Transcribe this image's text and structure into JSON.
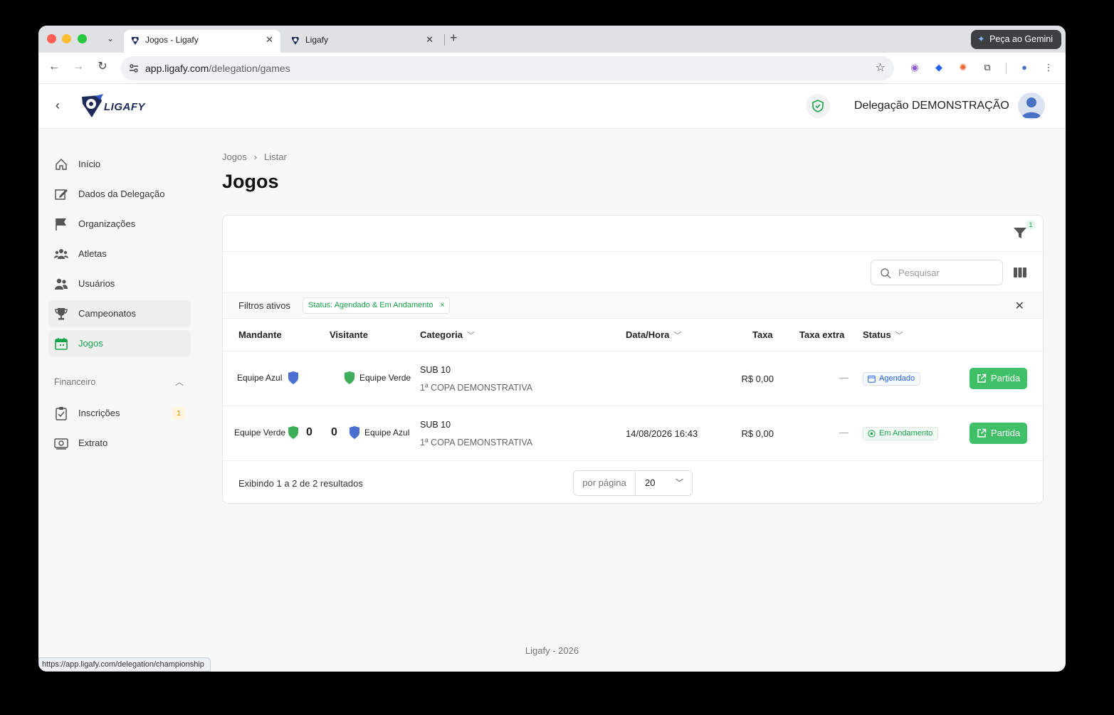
{
  "browser": {
    "tabs": [
      {
        "title": "Jogos - Ligafy",
        "active": true
      },
      {
        "title": "Ligafy",
        "active": false
      }
    ],
    "gemini_label": "Peça ao Gemini",
    "url_host": "app.ligafy.com",
    "url_path": "/delegation/games",
    "status_url": "https://app.ligafy.com/delegation/championship"
  },
  "header": {
    "logo_text": "LIGAFY",
    "delegation_name": "Delegação DEMONSTRAÇÃO"
  },
  "sidebar": {
    "items": [
      {
        "label": "Início",
        "icon": "home-icon"
      },
      {
        "label": "Dados da Delegação",
        "icon": "edit-icon"
      },
      {
        "label": "Organizações",
        "icon": "flag-icon"
      },
      {
        "label": "Atletas",
        "icon": "group-icon"
      },
      {
        "label": "Usuários",
        "icon": "users-icon"
      },
      {
        "label": "Campeonatos",
        "icon": "trophy-icon"
      },
      {
        "label": "Jogos",
        "icon": "calendar-icon"
      }
    ],
    "section_label": "Financeiro",
    "finance_items": [
      {
        "label": "Inscrições",
        "badge": "1",
        "icon": "clipboard-icon"
      },
      {
        "label": "Extrato",
        "icon": "money-icon"
      }
    ]
  },
  "breadcrumb": {
    "parent": "Jogos",
    "current": "Listar"
  },
  "page_title": "Jogos",
  "filter_count": "1",
  "search": {
    "placeholder": "Pesquisar"
  },
  "active_filters": {
    "label": "Filtros ativos",
    "chip": "Status: Agendado & Em Andamento",
    "chip_remove": "×"
  },
  "table": {
    "headers": {
      "mandante": "Mandante",
      "visitante": "Visitante",
      "categoria": "Categoria",
      "datahora": "Data/Hora",
      "taxa": "Taxa",
      "taxa_extra": "Taxa extra",
      "status": "Status"
    },
    "rows": [
      {
        "home": "Equipe Azul",
        "away": "Equipe Verde",
        "home_score": "",
        "away_score": "",
        "category": "SUB 10",
        "championship": "1ª COPA DEMONSTRATIVA",
        "datetime": "",
        "fee": "R$ 0,00",
        "extra_fee": "—",
        "status": "Agendado",
        "action": "Partida"
      },
      {
        "home": "Equipe Verde",
        "away": "Equipe Azul",
        "home_score": "0",
        "away_score": "0",
        "category": "SUB 10",
        "championship": "1ª COPA DEMONSTRATIVA",
        "datetime": "14/08/2026 16:43",
        "fee": "R$ 0,00",
        "extra_fee": "—",
        "status": "Em Andamento",
        "action": "Partida"
      }
    ]
  },
  "pagination": {
    "results_text": "Exibindo 1 a 2 de 2 resultados",
    "per_page_label": "por página",
    "per_page_value": "20"
  },
  "footer": "Ligafy - 2026",
  "colors": {
    "accent_green": "#16a34a",
    "button_green": "#3fbf66",
    "team_blue": "#4a6fd0",
    "team_green": "#3fae5a"
  }
}
